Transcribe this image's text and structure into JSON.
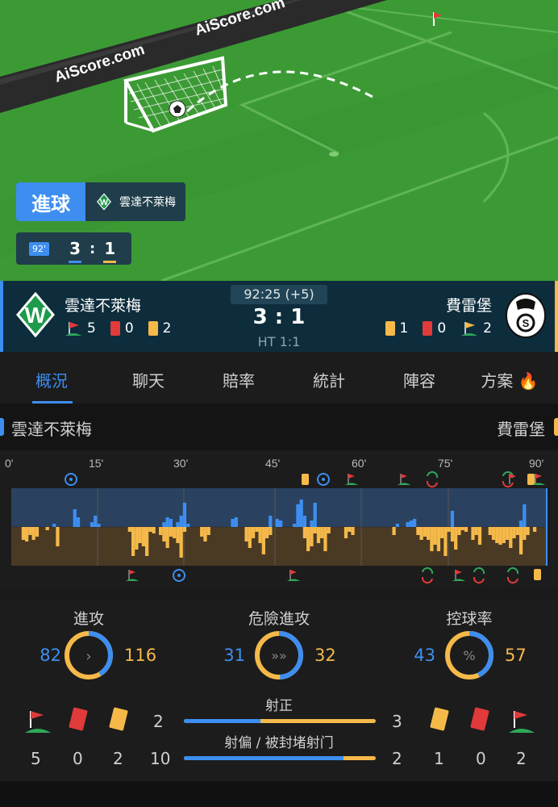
{
  "pitch": {
    "ad_text_1": "AiScore.com",
    "ad_text_2": "AiScore.com",
    "event_label": "進球",
    "event_team": "雲達不萊梅",
    "mini_minute": "92'",
    "mini_home": "3",
    "mini_sep": ":",
    "mini_away": "1"
  },
  "header": {
    "time": "92:25 (+5)",
    "score": "3 : 1",
    "halftime": "HT 1:1",
    "home": {
      "name": "雲達不萊梅",
      "corners": "5",
      "red": "0",
      "yellow": "2"
    },
    "away": {
      "name": "費雷堡",
      "yellow": "1",
      "red": "0",
      "corners": "2"
    }
  },
  "tabs": [
    "概況",
    "聊天",
    "賠率",
    "統計",
    "陣容",
    "方案"
  ],
  "teams_row": {
    "home": "雲達不萊梅",
    "away": "費雷堡"
  },
  "timeline": {
    "ticks": [
      "0'",
      "15'",
      "30'",
      "45'",
      "60'",
      "75'",
      "90'"
    ]
  },
  "stats": {
    "attack": {
      "label": "進攻",
      "home": "82",
      "away": "116",
      "home_val": 82,
      "away_val": 116
    },
    "dangerous": {
      "label": "危險進攻",
      "home": "31",
      "away": "32",
      "home_val": 31,
      "away_val": 32
    },
    "possession": {
      "label": "控球率",
      "home": "43",
      "away": "57",
      "home_val": 43,
      "away_val": 57
    },
    "home_counts": {
      "corners": "5",
      "red": "0",
      "yellow": "2"
    },
    "away_counts": {
      "yellow": "1",
      "red": "0",
      "corners": "2"
    },
    "on_target": {
      "label": "射正",
      "home": "2",
      "away": "3",
      "home_val": 2,
      "away_val": 3
    },
    "off_target": {
      "label": "射偏 / 被封堵射门",
      "home": "10",
      "away": "2",
      "home_val": 10,
      "away_val": 2
    }
  },
  "colors": {
    "home": "#3d8ef0",
    "away": "#f5b94a",
    "pitch": "#3c9a35"
  }
}
